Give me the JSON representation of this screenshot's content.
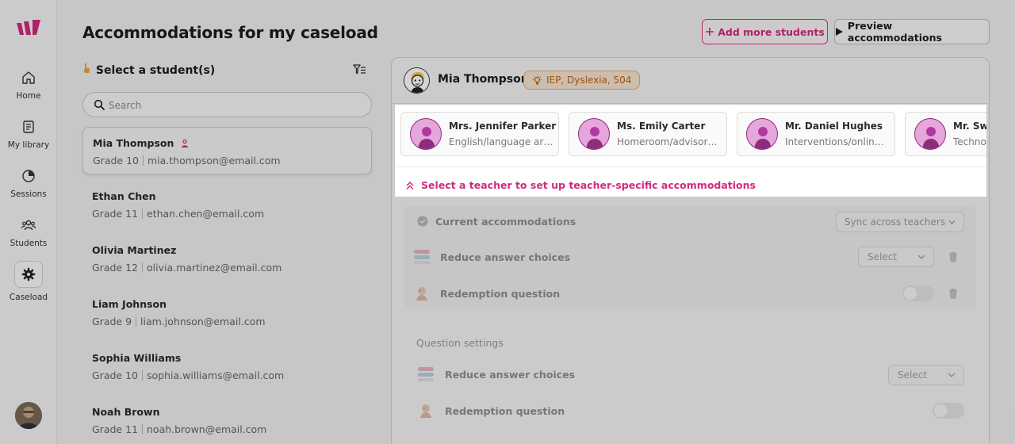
{
  "sidebar": {
    "items": [
      {
        "label": "Home",
        "icon": "home-icon"
      },
      {
        "label": "My library",
        "icon": "library-icon"
      },
      {
        "label": "Sessions",
        "icon": "sessions-icon"
      },
      {
        "label": "Students",
        "icon": "students-icon"
      },
      {
        "label": "Caseload",
        "icon": "gear-icon",
        "active": true
      }
    ]
  },
  "header": {
    "title": "Accommodations for my caseload",
    "add_students": "Add more students",
    "preview": "Preview accommodations"
  },
  "students_pane": {
    "heading": "Select a student(s)",
    "search_placeholder": "Search",
    "students": [
      {
        "name": "Mia Thompson",
        "grade": "Grade 10",
        "email": "mia.thompson@email.com",
        "selected": true
      },
      {
        "name": "Ethan Chen",
        "grade": "Grade 11",
        "email": "ethan.chen@email.com"
      },
      {
        "name": "Olivia Martinez",
        "grade": "Grade 12",
        "email": "olivia.martinez@email.com"
      },
      {
        "name": "Liam Johnson",
        "grade": "Grade 9",
        "email": "liam.johnson@email.com"
      },
      {
        "name": "Sophia Williams",
        "grade": "Grade 10",
        "email": "sophia.williams@email.com"
      },
      {
        "name": "Noah Brown",
        "grade": "Grade 11",
        "email": "noah.brown@email.com"
      }
    ]
  },
  "panel": {
    "student_name": "Mia Thompson",
    "tag": "IEP, Dyslexia, 504",
    "teachers": [
      {
        "name": "Mrs. Jennifer Parker",
        "subject": "English/language arts..."
      },
      {
        "name": "Ms. Emily Carter",
        "subject": "Homeroom/advisory,..."
      },
      {
        "name": "Mr. Daniel Hughes",
        "subject": "Interventions/online l..."
      },
      {
        "name": "Mr. Swa",
        "subject": "Technol"
      }
    ],
    "teacher_hint": "Select a teacher to set up teacher-specific accommodations",
    "current": {
      "title": "Current accommodations",
      "sync": "Sync across teachers",
      "rows": [
        {
          "label": "Reduce answer choices",
          "control": "select",
          "value": "Select"
        },
        {
          "label": "Redemption question",
          "control": "toggle"
        }
      ]
    },
    "question_settings": {
      "title": "Question settings",
      "rows": [
        {
          "label": "Reduce answer choices",
          "control": "select",
          "value": "Select"
        },
        {
          "label": "Redemption question",
          "control": "toggle"
        }
      ]
    }
  },
  "colors": {
    "accent": "#d12a7f",
    "tag_bg": "#f6e5d3",
    "tag_text": "#c0640c"
  }
}
